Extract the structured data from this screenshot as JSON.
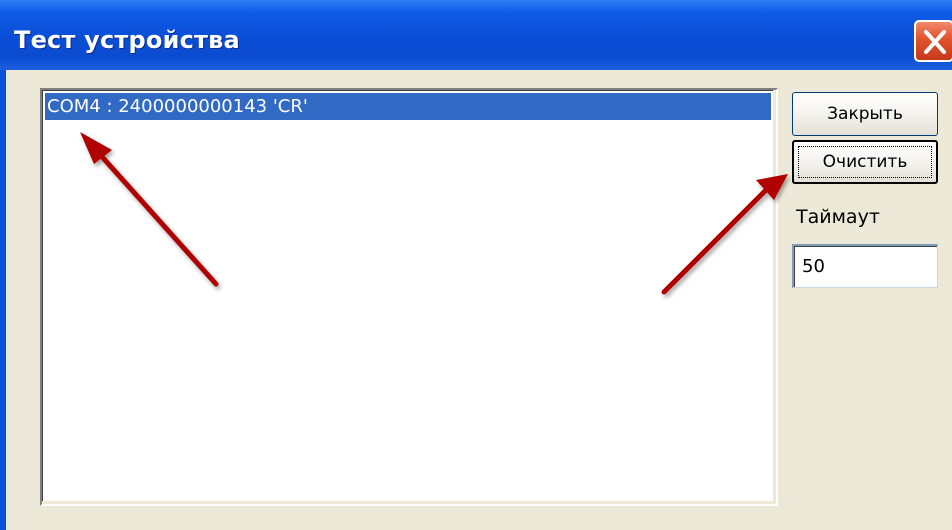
{
  "window": {
    "title": "Тест устройства",
    "close_icon": "close-icon"
  },
  "list": {
    "items": [
      {
        "text": "COM4 : 2400000000143 'CR'",
        "selected": true
      }
    ]
  },
  "buttons": {
    "close_label": "Закрыть",
    "clear_label": "Очистить"
  },
  "timeout": {
    "label": "Таймаут",
    "value": "50"
  },
  "annotations": {
    "arrow_color": "#B00000",
    "arrows": [
      "arrow-to-list-item",
      "arrow-to-clear-button"
    ]
  },
  "colors": {
    "titlebar": "#0A4FD8",
    "selection": "#316AC5",
    "dialog_bg": "#ECE9D8"
  }
}
